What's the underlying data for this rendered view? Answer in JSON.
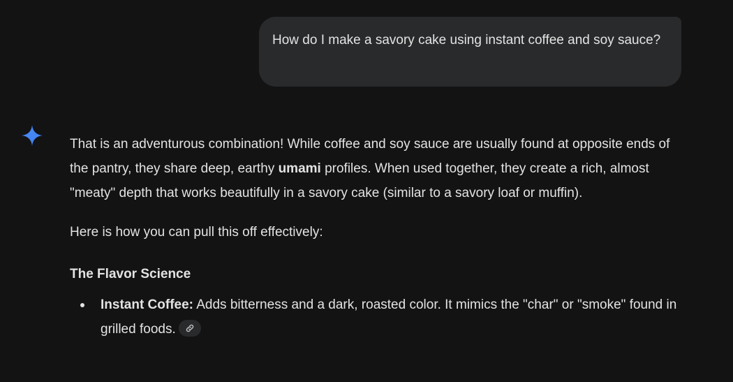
{
  "user_message": {
    "text": "How do I make a savory cake using instant coffee and soy sauce?"
  },
  "response": {
    "intro": {
      "part1": "That is an adventurous combination! While coffee and soy sauce are usually found at opposite ends of the pantry, they share deep, earthy ",
      "bold": "umami",
      "part2": " profiles. When used together, they create a rich, almost \"meaty\" depth that works beautifully in a savory cake (similar to a savory loaf or muffin)."
    },
    "lead": "Here is how you can pull this off effectively:",
    "section_heading": "The Flavor Science",
    "bullets": [
      {
        "label": "Instant Coffee:",
        "text": " Adds bitterness and a dark, roasted color. It mimics the \"char\" or \"smoke\" found in grilled foods."
      }
    ]
  },
  "icons": {
    "assistant": "gemini-sparkle-icon",
    "source_link": "link-icon"
  },
  "colors": {
    "background": "#131314",
    "bubble": "#282a2c",
    "text": "#e3e3e3",
    "sparkle": "#4b8df8"
  }
}
